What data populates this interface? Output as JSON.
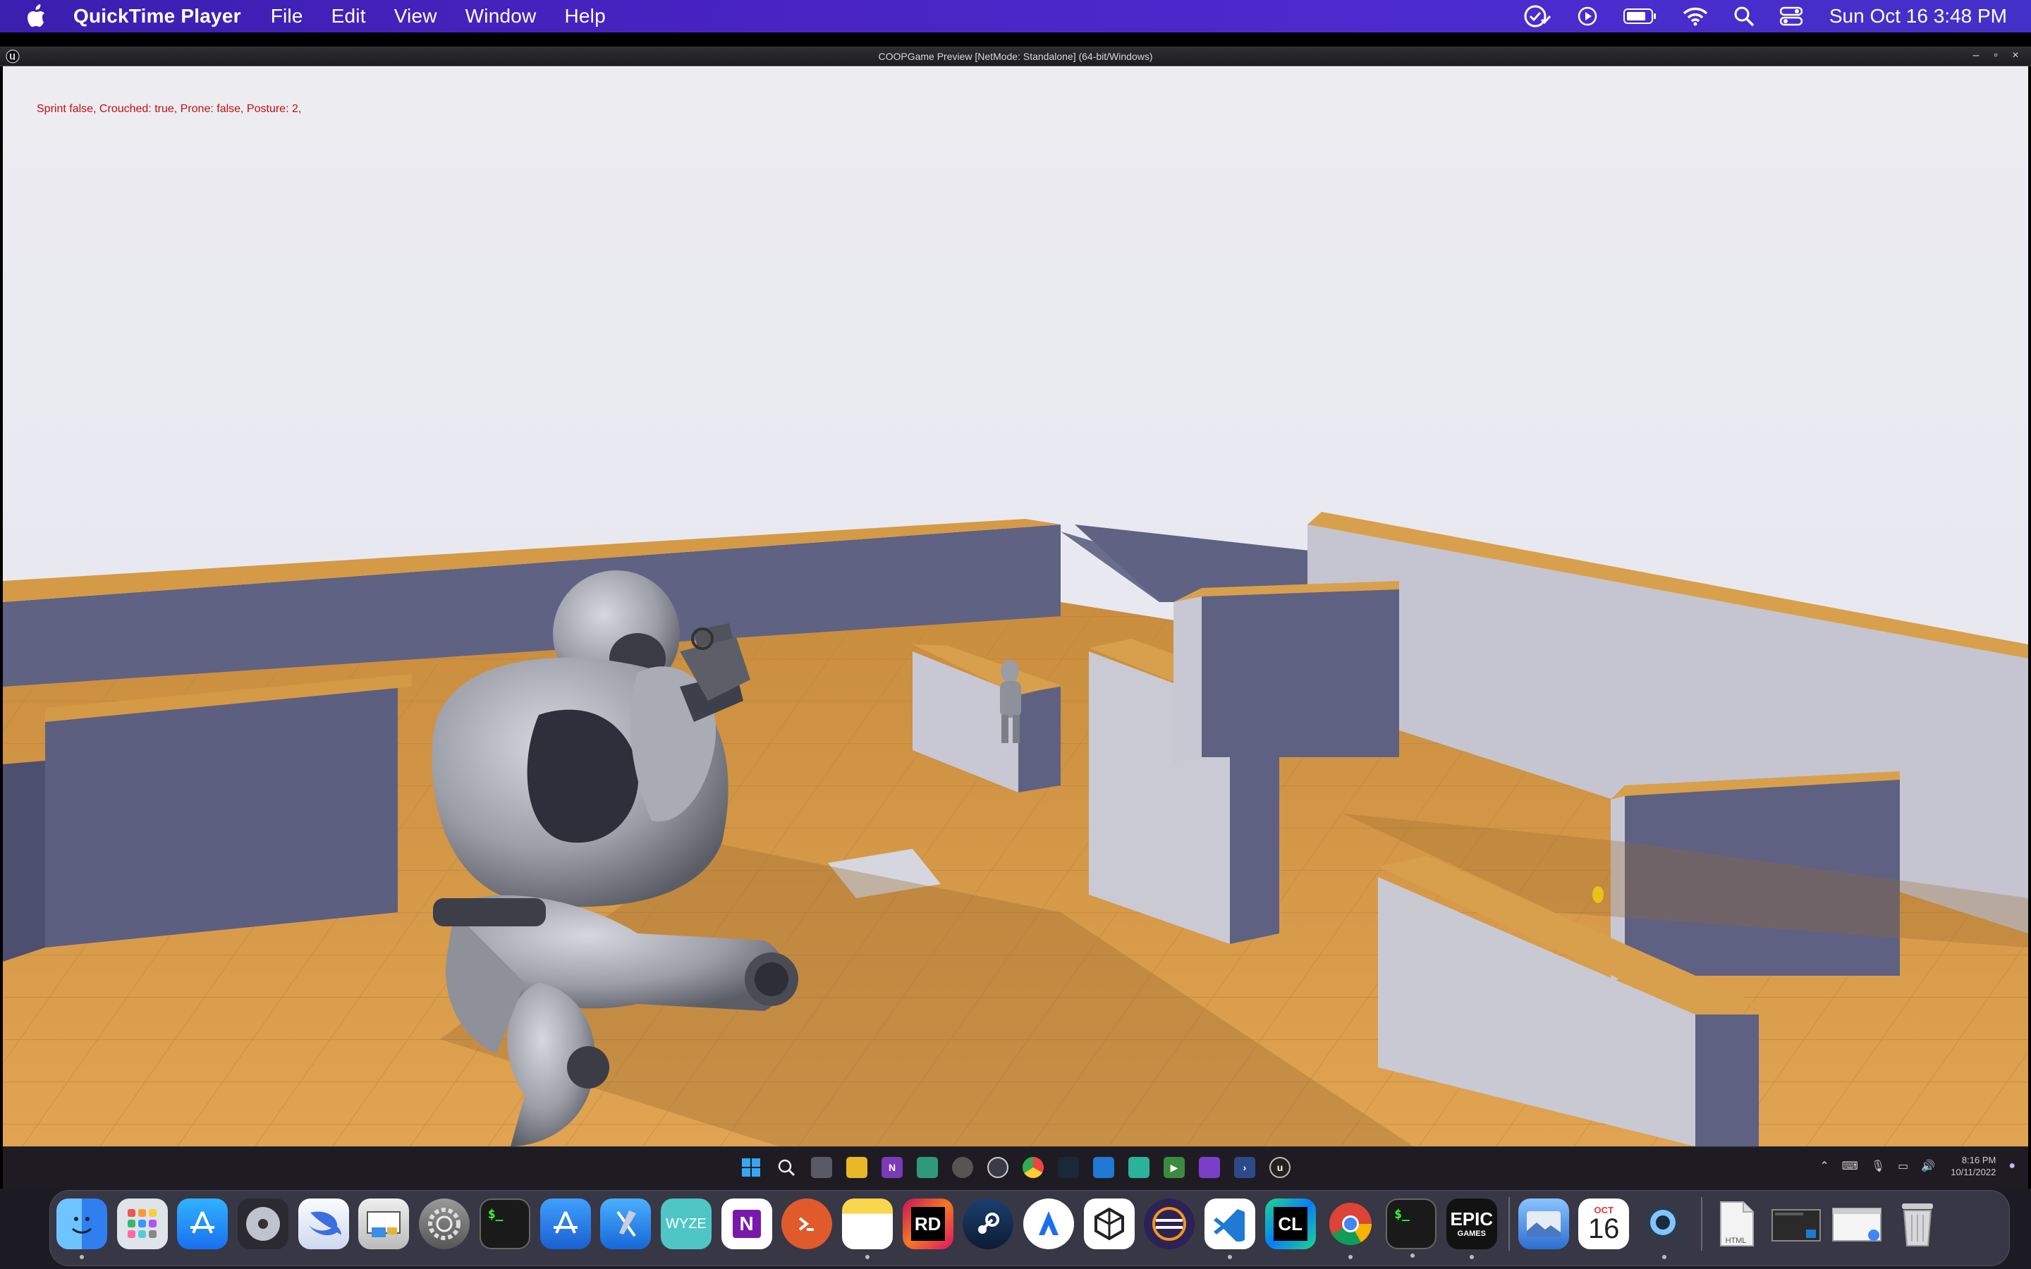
{
  "menubar": {
    "app_name": "QuickTime Player",
    "menus": [
      "File",
      "Edit",
      "View",
      "Window",
      "Help"
    ],
    "status_icons": [
      "checklist-icon",
      "play-circle-icon",
      "battery-icon",
      "wifi-icon",
      "spotlight-search-icon",
      "control-center-icon"
    ],
    "clock": "Sun Oct 16  3:48 PM"
  },
  "window": {
    "title": "COOPGame Preview [NetMode: Standalone]  (64-bit/Windows)",
    "buttons": [
      "minimize",
      "maximize",
      "close"
    ]
  },
  "game": {
    "debug_text": "Sprint false, Crouched: true, Prone: false, Posture: 2,",
    "colors": {
      "sky": "#e9eaf2",
      "floor": "#d99a45",
      "wall_dark": "#5e6180",
      "wall_light": "#c7c8d2"
    }
  },
  "windows_taskbar": {
    "time": "8:16 PM",
    "date": "10/11/2022",
    "icons": [
      "windows-start-icon",
      "search-icon",
      "task-view-icon",
      "file-explorer-icon",
      "onenote-icon",
      "app-icon",
      "chrome-canary-icon",
      "obs-icon",
      "chrome-icon",
      "steam-icon",
      "vscode-icon",
      "app-icon",
      "rider-icon",
      "visual-studio-icon",
      "powershell-icon",
      "unreal-engine-icon"
    ]
  },
  "dock": {
    "apps": [
      {
        "name": "Finder",
        "icon": "finder-icon",
        "running": true
      },
      {
        "name": "Launchpad",
        "icon": "launchpad-icon",
        "running": false
      },
      {
        "name": "App Store",
        "icon": "app-store-icon",
        "running": false
      },
      {
        "name": "Logic",
        "icon": "disc-icon",
        "running": false
      },
      {
        "name": "Swift Playgrounds",
        "icon": "swift-icon",
        "running": false
      },
      {
        "name": "Preview",
        "icon": "preview-icon",
        "running": false
      },
      {
        "name": "System Preferences",
        "icon": "settings-icon",
        "running": false
      },
      {
        "name": "Terminal",
        "icon": "terminal-icon",
        "running": false
      },
      {
        "name": "Simulator",
        "icon": "simulator-icon",
        "running": false
      },
      {
        "name": "Xcode",
        "icon": "xcode-icon",
        "running": false
      },
      {
        "name": "Wyze",
        "icon": "wyze-icon",
        "label": "WYZE",
        "running": false
      },
      {
        "name": "OneNote",
        "icon": "onenote-icon",
        "label": "N",
        "running": false
      },
      {
        "name": "Remote Desktop",
        "icon": "remote-desktop-icon",
        "running": false
      },
      {
        "name": "Notes",
        "icon": "notes-icon",
        "running": true
      },
      {
        "name": "Rider",
        "icon": "rider-icon",
        "label": "RD",
        "running": false
      },
      {
        "name": "Steam",
        "icon": "steam-icon",
        "running": false
      },
      {
        "name": "Altool",
        "icon": "altool-icon",
        "running": false
      },
      {
        "name": "Unity",
        "icon": "unity-icon",
        "running": false
      },
      {
        "name": "Eclipse",
        "icon": "eclipse-icon",
        "running": false
      },
      {
        "name": "Visual Studio Code",
        "icon": "vscode-icon",
        "running": true
      },
      {
        "name": "CLion",
        "icon": "clion-icon",
        "label": "CL",
        "running": false
      },
      {
        "name": "Chrome",
        "icon": "chrome-icon",
        "running": true
      },
      {
        "name": "Terminal 2",
        "icon": "terminal-icon",
        "running": true
      },
      {
        "name": "Epic Games",
        "icon": "epic-games-icon",
        "label": "EPIC",
        "label2": "GAMES",
        "running": true
      }
    ],
    "apps_right": [
      {
        "name": "Preview",
        "icon": "photos-icon",
        "running": false
      },
      {
        "name": "Calendar",
        "icon": "calendar-icon",
        "month": "OCT",
        "day": "16",
        "running": false
      },
      {
        "name": "QuickTime Player",
        "icon": "quicktime-icon",
        "running": true
      }
    ],
    "docs": [
      {
        "name": "HTML",
        "icon": "html-file-icon",
        "label": "HTML"
      },
      {
        "name": "Screenshot",
        "icon": "screenshot-stack-icon"
      },
      {
        "name": "Window",
        "icon": "window-stack-icon"
      },
      {
        "name": "Trash",
        "icon": "trash-icon"
      }
    ]
  }
}
